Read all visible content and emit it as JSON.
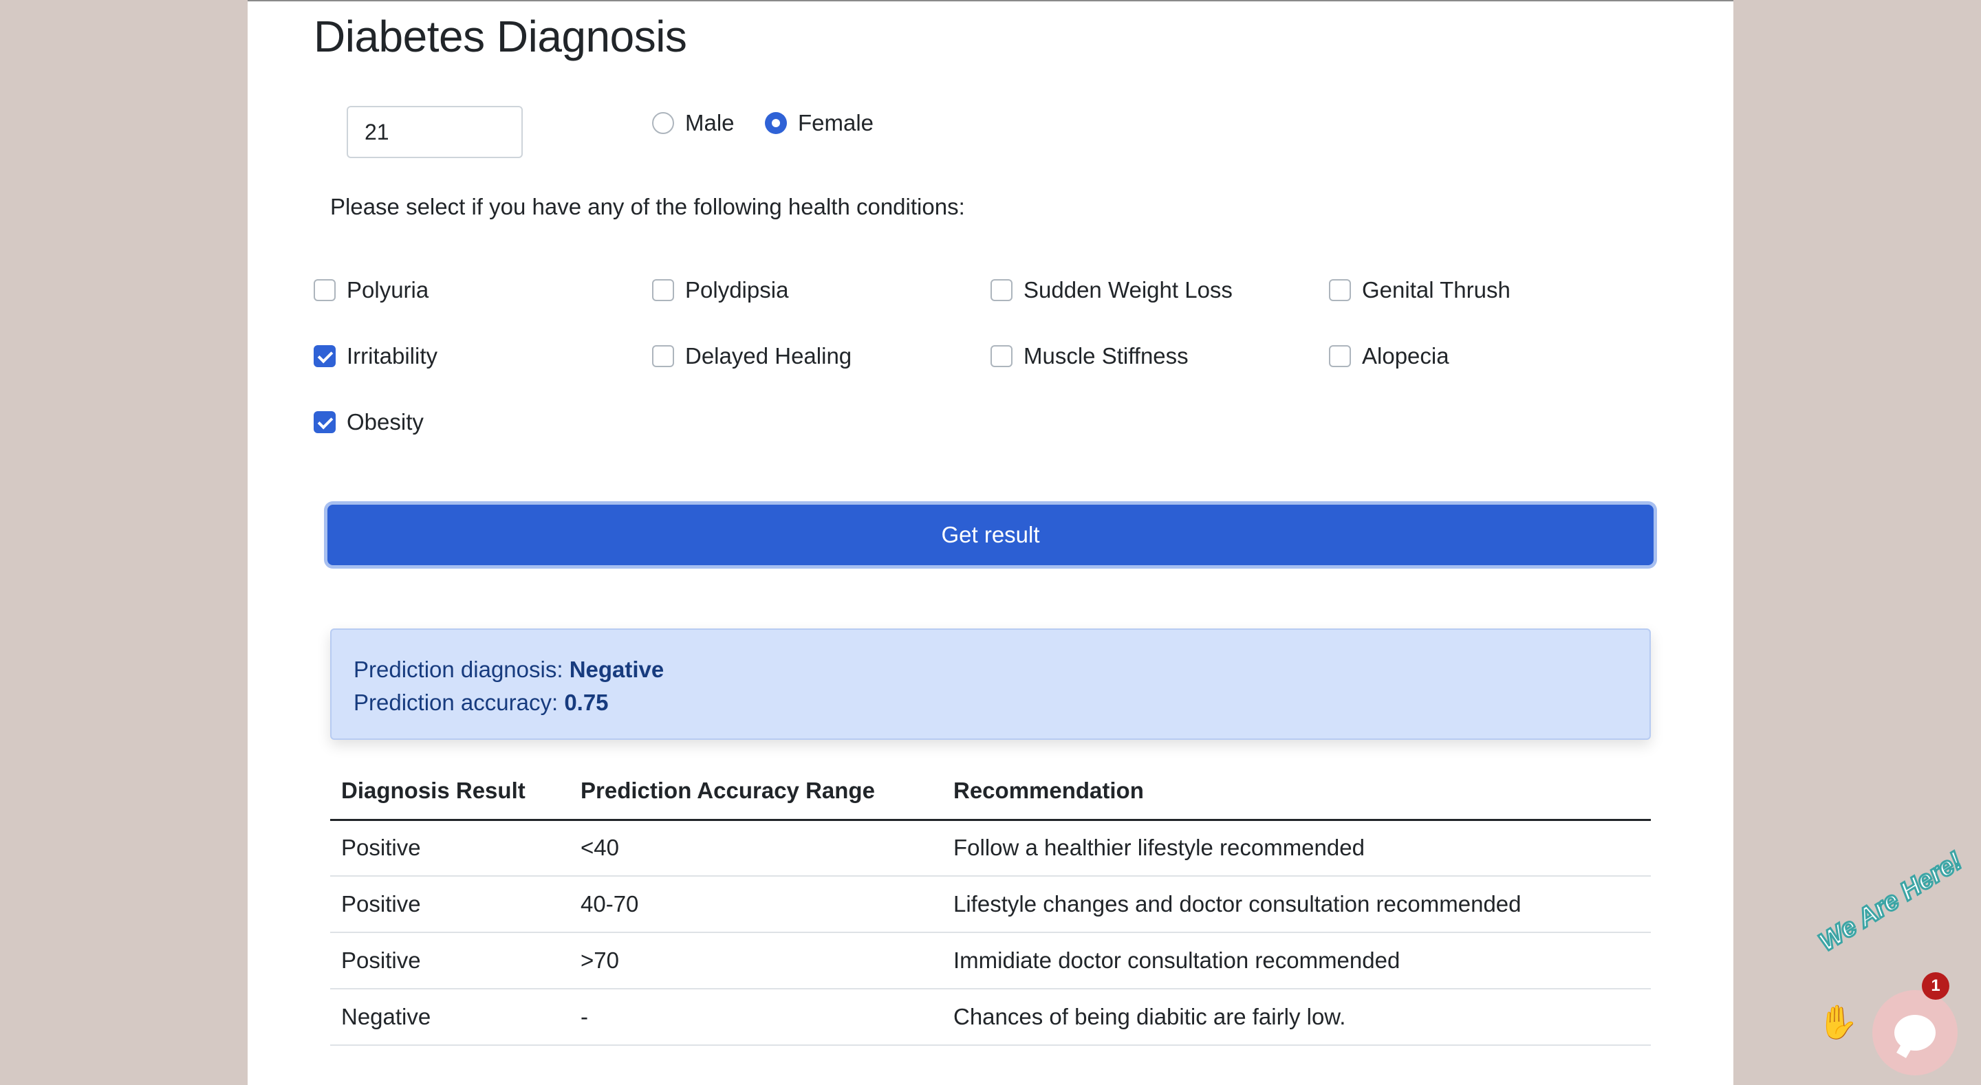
{
  "page": {
    "title": "Diabetes Diagnosis"
  },
  "form": {
    "age_value": "21",
    "gender": {
      "options": [
        {
          "label": "Male",
          "checked": false
        },
        {
          "label": "Female",
          "checked": true
        }
      ]
    },
    "prompt": "Please select if you have any of the following health conditions:",
    "conditions": [
      {
        "label": "Polyuria",
        "checked": false
      },
      {
        "label": "Polydipsia",
        "checked": false
      },
      {
        "label": "Sudden Weight Loss",
        "checked": false
      },
      {
        "label": "Genital Thrush",
        "checked": false
      },
      {
        "label": "Irritability",
        "checked": true
      },
      {
        "label": "Delayed Healing",
        "checked": false
      },
      {
        "label": "Muscle Stiffness",
        "checked": false
      },
      {
        "label": "Alopecia",
        "checked": false
      },
      {
        "label": "Obesity",
        "checked": true
      }
    ],
    "submit_label": "Get result"
  },
  "result": {
    "diagnosis_label": "Prediction diagnosis:",
    "diagnosis_value": "Negative",
    "accuracy_label": "Prediction accuracy:",
    "accuracy_value": "0.75"
  },
  "table": {
    "headers": [
      "Diagnosis Result",
      "Prediction Accuracy Range",
      "Recommendation"
    ],
    "rows": [
      [
        "Positive",
        "<40",
        "Follow a healthier lifestyle recommended"
      ],
      [
        "Positive",
        "40-70",
        "Lifestyle changes and doctor consultation recommended"
      ],
      [
        "Positive",
        ">70",
        "Immidiate doctor consultation recommended"
      ],
      [
        "Negative",
        "-",
        "Chances of being diabitic are fairly low."
      ]
    ]
  },
  "chat_widget": {
    "banner": "We Are Here!",
    "badge_count": "1",
    "icon": "chat-icon"
  },
  "colors": {
    "primary": "#2c5fd3",
    "alert_bg": "#d3e1fb",
    "page_bg": "#d5c9c4"
  }
}
